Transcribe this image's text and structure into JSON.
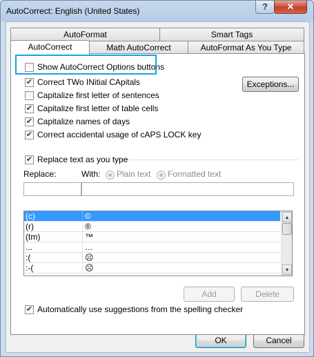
{
  "window": {
    "title": "AutoCorrect: English (United States)",
    "help": "?",
    "close": "✕"
  },
  "tabs": {
    "row_back": [
      "AutoFormat",
      "Smart Tags"
    ],
    "row_front": [
      "AutoCorrect",
      "Math AutoCorrect",
      "AutoFormat As You Type"
    ],
    "active": "AutoCorrect"
  },
  "options": {
    "show_buttons": {
      "label": "Show AutoCorrect Options buttons",
      "checked": false
    },
    "correct_two_initial": {
      "label": "Correct TWo INitial CApitals",
      "checked": true
    },
    "capitalize_sentences": {
      "label": "Capitalize first letter of sentences",
      "checked": false
    },
    "capitalize_table_cells": {
      "label": "Capitalize first letter of table cells",
      "checked": true
    },
    "capitalize_days": {
      "label": "Capitalize names of days",
      "checked": true
    },
    "caps_lock": {
      "label": "Correct accidental usage of cAPS LOCK key",
      "checked": true
    },
    "replace_text": {
      "label": "Replace text as you type",
      "checked": true
    },
    "auto_suggest": {
      "label": "Automatically use suggestions from the spelling checker",
      "checked": true
    }
  },
  "exceptions_button": "Exceptions...",
  "replace": {
    "replace_label": "Replace:",
    "with_label": "With:",
    "plain_text": "Plain text",
    "formatted_text": "Formatted text",
    "replace_value": "",
    "with_value": ""
  },
  "entries": [
    {
      "from": "(c)",
      "to": "©",
      "selected": true
    },
    {
      "from": "(r)",
      "to": "®",
      "selected": false
    },
    {
      "from": "(tm)",
      "to": "™",
      "selected": false
    },
    {
      "from": "...",
      "to": "…",
      "selected": false
    },
    {
      "from": ":(",
      "to": "☹",
      "selected": false
    },
    {
      "from": ":-(",
      "to": "☹",
      "selected": false
    }
  ],
  "buttons": {
    "add": "Add",
    "delete": "Delete",
    "ok": "OK",
    "cancel": "Cancel"
  },
  "colors": {
    "highlight": "#1ba1e2",
    "selection": "#3399ff"
  }
}
